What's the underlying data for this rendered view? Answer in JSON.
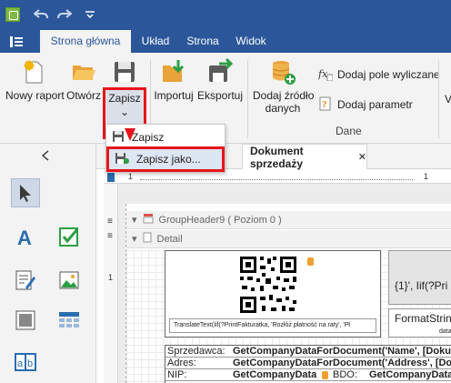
{
  "titlebar": {
    "logo_icon": "app-logo-icon",
    "undo_icon": "undo-icon",
    "redo_icon": "redo-icon",
    "more_icon": "quick-access-dropdown-icon"
  },
  "ribbon_tabs": [
    "Strona główna",
    "Układ",
    "Strona",
    "Widok"
  ],
  "ribbon": {
    "nowy_raport": "Nowy raport",
    "otworz": "Otwórz",
    "zapisz": "Zapisz",
    "importuj": "Importuj",
    "eksportuj": "Eksportuj",
    "dodaj_zrodlo_line1": "Dodaj źródło",
    "dodaj_zrodlo_line2": "danych",
    "dodaj_pole": "Dodaj pole wyliczane",
    "dodaj_parametr": "Dodaj parametr",
    "dane_group": "Dane",
    "chevron": "⌄"
  },
  "menu": {
    "zapisz": "Zapisz",
    "zapisz_jako": "Zapisz jako..."
  },
  "document": {
    "tab_title": "Dokument sprzedaży",
    "close": "✕",
    "ruler_marks": [
      "1",
      "1"
    ],
    "vertical_marks": [
      "1"
    ],
    "band_group_header": "GroupHeader9 ( Poziom 0 )",
    "band_detail": "Detail",
    "qr_caption": "TranslateText(Iif(?PrintFakturatka, 'Rozłóż płatność na raty', 'Pł",
    "gray_text": "{1}', Iif(?Pri",
    "fmt_text": "FormatStrin",
    "fmt_sub": "data",
    "rows": [
      {
        "label": "Sprzedawca:",
        "value": "GetCompanyDataForDocument('Name', [Doku"
      },
      {
        "label": "Adres:",
        "value": "GetCompanyDataForDocument('Address', [Do"
      },
      {
        "label": "NIP:",
        "value": "GetCompanyData",
        "label2": "BDO:",
        "value2": "GetCompanyData"
      }
    ]
  },
  "colors": {
    "accent": "#2b579a",
    "highlight_red": "#e8141b"
  }
}
